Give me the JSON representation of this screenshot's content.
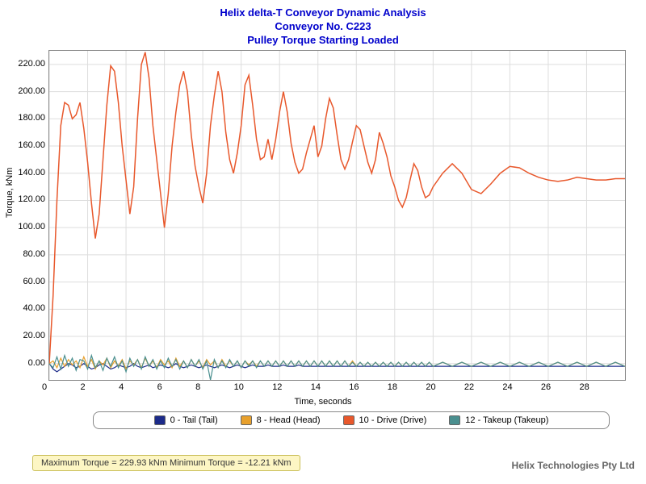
{
  "title": {
    "line1": "Helix delta-T Conveyor Dynamic Analysis",
    "line2": "Conveyor No. C223",
    "line3": "Pulley Torque Starting Loaded"
  },
  "axes": {
    "xlabel": "Time, seconds",
    "ylabel": "Torque, kNm",
    "xmin": 0,
    "xmax": 30,
    "ymin": -12,
    "ymax": 230,
    "xticks": [
      0,
      2,
      4,
      6,
      8,
      10,
      12,
      14,
      16,
      18,
      20,
      22,
      24,
      26,
      28
    ],
    "yticks": [
      0,
      20,
      40,
      60,
      80,
      100,
      120,
      140,
      160,
      180,
      200,
      220
    ],
    "ytickfmt": [
      "0.00",
      "20.00",
      "40.00",
      "60.00",
      "80.00",
      "100.00",
      "120.00",
      "140.00",
      "160.00",
      "180.00",
      "200.00",
      "220.00"
    ]
  },
  "legend": [
    {
      "color": "#1c2b8a",
      "label": "0 - Tail (Tail)"
    },
    {
      "color": "#e8a02c",
      "label": "8 - Head (Head)"
    },
    {
      "color": "#e8582c",
      "label": "10 - Drive (Drive)"
    },
    {
      "color": "#4a8f8f",
      "label": "12 - Takeup (Takeup)"
    }
  ],
  "status": "Maximum Torque = 229.93 kNm Minimum Torque = -12.21 kNm",
  "footer": "Helix Technologies Pty Ltd",
  "chart_data": {
    "type": "line",
    "title": "Pulley Torque Starting Loaded",
    "xlabel": "Time, seconds",
    "ylabel": "Torque, kNm",
    "ylim": [
      -12.21,
      229.93
    ],
    "xlim": [
      0,
      30
    ],
    "x": [
      0,
      0.2,
      0.4,
      0.6,
      0.8,
      1,
      1.2,
      1.4,
      1.6,
      1.8,
      2,
      2.2,
      2.4,
      2.6,
      2.8,
      3,
      3.2,
      3.4,
      3.6,
      3.8,
      4,
      4.2,
      4.4,
      4.6,
      4.8,
      5,
      5.2,
      5.4,
      5.6,
      5.8,
      6,
      6.2,
      6.4,
      6.6,
      6.8,
      7,
      7.2,
      7.4,
      7.6,
      7.8,
      8,
      8.2,
      8.4,
      8.6,
      8.8,
      9,
      9.2,
      9.4,
      9.6,
      9.8,
      10,
      10.2,
      10.4,
      10.6,
      10.8,
      11,
      11.2,
      11.4,
      11.6,
      11.8,
      12,
      12.2,
      12.4,
      12.6,
      12.8,
      13,
      13.2,
      13.4,
      13.6,
      13.8,
      14,
      14.2,
      14.4,
      14.6,
      14.8,
      15,
      15.2,
      15.4,
      15.6,
      15.8,
      16,
      16.2,
      16.4,
      16.6,
      16.8,
      17,
      17.2,
      17.4,
      17.6,
      17.8,
      18,
      18.2,
      18.4,
      18.6,
      18.8,
      19,
      19.2,
      19.4,
      19.6,
      19.8,
      20,
      20.5,
      21,
      21.5,
      22,
      22.5,
      23,
      23.5,
      24,
      24.5,
      25,
      25.5,
      26,
      26.5,
      27,
      27.5,
      28,
      28.5,
      29,
      29.5,
      30
    ],
    "series": [
      {
        "name": "10 - Drive (Drive)",
        "color": "#e8582c",
        "values": [
          0,
          50,
          120,
          175,
          192,
          190,
          180,
          183,
          192,
          173,
          148,
          118,
          92,
          110,
          150,
          190,
          219,
          215,
          192,
          160,
          135,
          110,
          130,
          180,
          220,
          229,
          210,
          175,
          150,
          125,
          100,
          125,
          160,
          185,
          205,
          215,
          200,
          168,
          145,
          130,
          118,
          140,
          175,
          197,
          215,
          200,
          170,
          150,
          140,
          155,
          175,
          205,
          212,
          190,
          165,
          150,
          152,
          165,
          150,
          165,
          185,
          200,
          185,
          162,
          148,
          140,
          143,
          155,
          165,
          175,
          152,
          160,
          180,
          195,
          188,
          168,
          150,
          143,
          150,
          163,
          175,
          172,
          160,
          148,
          140,
          150,
          170,
          162,
          152,
          138,
          130,
          120,
          115,
          122,
          135,
          147,
          142,
          130,
          122,
          124,
          130,
          140,
          147,
          140,
          128,
          125,
          132,
          140,
          145,
          144,
          140,
          137,
          135,
          134,
          135,
          137,
          136,
          135,
          135,
          136,
          136
        ],
        "width": 1.5
      },
      {
        "name": "0 - Tail (Tail)",
        "color": "#1c2b8a",
        "values": [
          0,
          -4,
          -6,
          -4,
          -2,
          0,
          -1,
          -3,
          -2,
          0,
          -2,
          -4,
          -3,
          -1,
          0,
          -2,
          -4,
          -3,
          -1,
          -2,
          -3,
          -2,
          0,
          -2,
          -3,
          -2,
          -1,
          -3,
          -2,
          -1,
          -2,
          -3,
          -2,
          0,
          -2,
          -3,
          -2,
          -1,
          -2,
          -3,
          -2,
          -1,
          -2,
          -3,
          -2,
          -1,
          -2,
          -3,
          -2,
          -1,
          -2,
          -3,
          -2,
          -1,
          -2,
          -2,
          -2,
          -1,
          -2,
          -2,
          -2,
          -1,
          -2,
          -2,
          -2,
          -1,
          -2,
          -2,
          -2,
          -2,
          -2,
          -2,
          -2,
          -2,
          -2,
          -2,
          -2,
          -2,
          -2,
          -2,
          -2,
          -2,
          -2,
          -2,
          -2,
          -2,
          -2,
          -2,
          -2,
          -2,
          -2,
          -2,
          -2,
          -2,
          -2,
          -2,
          -2,
          -2,
          -2,
          -2,
          -2,
          -2,
          -2,
          -2,
          -2,
          -2,
          -2,
          -2,
          -2,
          -2,
          -2,
          -2,
          -2,
          -2,
          -2,
          -2,
          -2,
          -2,
          -2,
          -2,
          -2
        ],
        "width": 1.2
      },
      {
        "name": "8 - Head (Head)",
        "color": "#e8a02c",
        "values": [
          0,
          2,
          -3,
          4,
          -2,
          3,
          -1,
          2,
          -3,
          5,
          -2,
          3,
          -4,
          2,
          -1,
          4,
          -3,
          2,
          -2,
          3,
          -4,
          2,
          -1,
          3,
          -3,
          4,
          -2,
          2,
          -3,
          3,
          -1,
          2,
          -3,
          4,
          -2,
          2,
          -3,
          3,
          -2,
          2,
          -3,
          3,
          -1,
          2,
          -3,
          3,
          -2,
          2,
          -2,
          2,
          -3,
          2,
          -1,
          2,
          -2,
          2,
          -2,
          2,
          -2,
          2,
          -2,
          2,
          -2,
          2,
          -2,
          2,
          -2,
          2,
          -2,
          2,
          -2,
          2,
          -2,
          2,
          -2,
          2,
          -2,
          2,
          -2,
          2,
          -2,
          1,
          -2,
          1,
          -2,
          1,
          -2,
          1,
          -2,
          1,
          -2,
          1,
          -2,
          1,
          -2,
          1,
          -2,
          1,
          -2,
          1,
          -2,
          1,
          -2,
          1,
          -2,
          1,
          -2,
          1,
          -2,
          1,
          -2,
          1,
          -2,
          1,
          -2,
          1,
          -2,
          1,
          -2,
          1,
          -2
        ],
        "width": 1.2
      },
      {
        "name": "12 - Takeup (Takeup)",
        "color": "#4a8f8f",
        "values": [
          0,
          -3,
          5,
          -4,
          6,
          -2,
          4,
          -5,
          3,
          2,
          -4,
          6,
          -3,
          2,
          -5,
          4,
          -2,
          5,
          -3,
          2,
          -6,
          4,
          -2,
          3,
          -4,
          5,
          -2,
          3,
          -4,
          2,
          -3,
          4,
          -2,
          3,
          -4,
          2,
          -3,
          3,
          -2,
          3,
          -4,
          2,
          -12,
          3,
          -3,
          2,
          -3,
          3,
          -2,
          2,
          -3,
          2,
          -2,
          2,
          -3,
          2,
          -2,
          2,
          -2,
          2,
          -2,
          2,
          -2,
          2,
          -2,
          2,
          -2,
          2,
          -2,
          2,
          -2,
          2,
          -2,
          2,
          -2,
          2,
          -2,
          2,
          -2,
          1,
          -2,
          1,
          -2,
          1,
          -2,
          1,
          -2,
          1,
          -2,
          1,
          -2,
          1,
          -2,
          1,
          -2,
          1,
          -2,
          1,
          -2,
          1,
          -2,
          1,
          -2,
          1,
          -2,
          1,
          -2,
          1,
          -2,
          1,
          -2,
          1,
          -2,
          1,
          -2,
          1,
          -2,
          1,
          -2,
          1,
          -2
        ],
        "width": 1.2
      }
    ]
  }
}
